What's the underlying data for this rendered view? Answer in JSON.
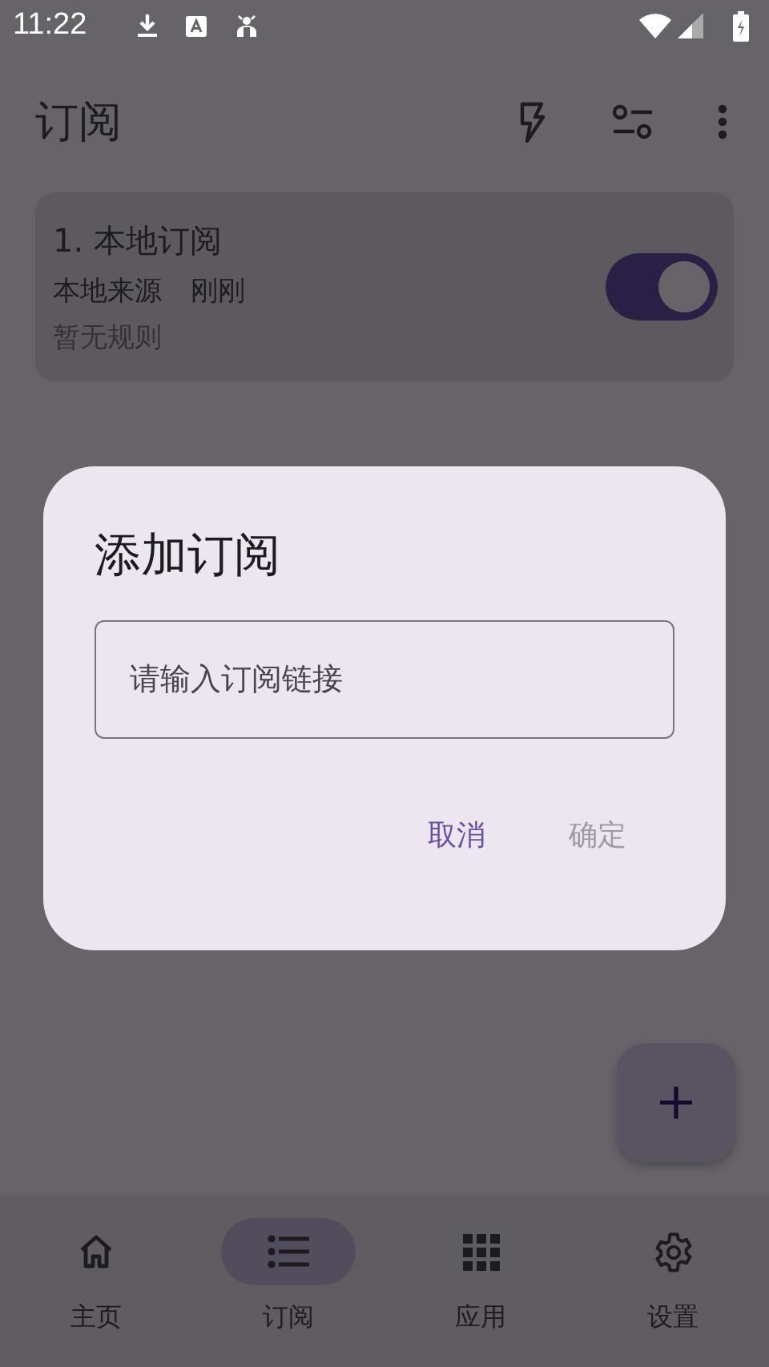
{
  "status_bar": {
    "time": "11:22"
  },
  "app_bar": {
    "title": "订阅"
  },
  "subscriptions": [
    {
      "title": "1. 本地订阅",
      "source": "本地来源",
      "updated": "刚刚",
      "rules": "暂无规则",
      "enabled": true
    }
  ],
  "dialog": {
    "title": "添加订阅",
    "placeholder": "请输入订阅链接",
    "buttons": [
      {
        "label": "取消",
        "disabled": false
      },
      {
        "label": "确定",
        "disabled": true
      }
    ]
  },
  "nav": [
    {
      "kind": "home",
      "label": "主页",
      "selected": false
    },
    {
      "kind": "list",
      "label": "订阅",
      "selected": true
    },
    {
      "kind": "apps",
      "label": "应用",
      "selected": false
    },
    {
      "kind": "settings",
      "label": "设置",
      "selected": false
    }
  ]
}
